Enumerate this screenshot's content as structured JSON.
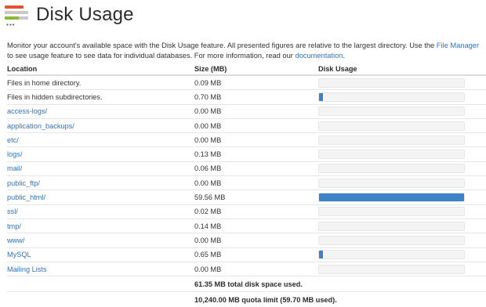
{
  "header": {
    "title": "Disk Usage",
    "icon": "disk-usage-icon"
  },
  "description": {
    "text_1": "Monitor your account's available space with the Disk Usage feature. All presented figures are relative to the largest directory. Use the ",
    "link_file_manager": "File Manager",
    "text_2": " to see usage feature to see data for individual databases. For more information, read our ",
    "link_documentation": "documentation",
    "text_3": "."
  },
  "table": {
    "columns": {
      "location": "Location",
      "size": "Size (MB)",
      "usage": "Disk Usage"
    },
    "rows": [
      {
        "location": "Files in home directory.",
        "size": "0.09 MB",
        "link": false,
        "usage_fraction": 0.0015
      },
      {
        "location": "Files in hidden subdirectories.",
        "size": "0.70 MB",
        "link": false,
        "usage_fraction": 0.0118
      },
      {
        "location": "access-logs/",
        "size": "0.00 MB",
        "link": true,
        "usage_fraction": 0
      },
      {
        "location": "application_backups/",
        "size": "0.00 MB",
        "link": true,
        "usage_fraction": 0
      },
      {
        "location": "etc/",
        "size": "0.00 MB",
        "link": true,
        "usage_fraction": 0
      },
      {
        "location": "logs/",
        "size": "0.13 MB",
        "link": true,
        "usage_fraction": 0.0022
      },
      {
        "location": "mail/",
        "size": "0.06 MB",
        "link": true,
        "usage_fraction": 0.001
      },
      {
        "location": "public_ftp/",
        "size": "0.00 MB",
        "link": true,
        "usage_fraction": 0
      },
      {
        "location": "public_html/",
        "size": "59.56 MB",
        "link": true,
        "usage_fraction": 1.0
      },
      {
        "location": "ssl/",
        "size": "0.02 MB",
        "link": true,
        "usage_fraction": 0.0003
      },
      {
        "location": "tmp/",
        "size": "0.14 MB",
        "link": true,
        "usage_fraction": 0.0024
      },
      {
        "location": "www/",
        "size": "0.00 MB",
        "link": true,
        "usage_fraction": 0
      },
      {
        "location": "MySQL",
        "size": "0.65 MB",
        "link": true,
        "usage_fraction": 0.0109
      },
      {
        "location": "Mailing Lists",
        "size": "0.00 MB",
        "link": true,
        "usage_fraction": 0
      }
    ],
    "total_used": "61.35 MB total disk space used.",
    "quota_limit": "10,240.00 MB quota limit (59.70 MB used)."
  },
  "colors": {
    "link": "#2f74c0",
    "bar_fill": "#3b82c6",
    "bar_bg": "#f4f4f4"
  }
}
